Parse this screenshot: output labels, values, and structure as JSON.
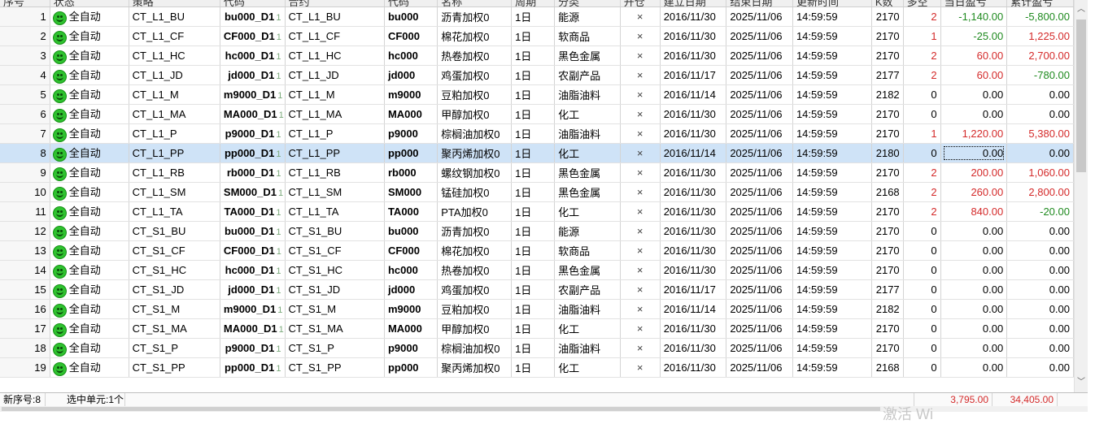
{
  "columns": [
    "序号",
    "状态",
    "策略",
    "代码",
    "合约",
    "代码",
    "名称",
    "周期",
    "分类",
    "开仓",
    "建立日期",
    "结束日期",
    "更新时间",
    "K数",
    "多空",
    "当日盈亏",
    "累计盈亏"
  ],
  "rows": [
    {
      "no": "1",
      "status": "全自动",
      "strategy": "CT_L1_BU",
      "code": "bu000_D1",
      "code_tail": "1",
      "contract": "CT_L1_BU",
      "instr": "bu000",
      "name": "沥青加权0",
      "period": "1日",
      "category": "能源",
      "open": "×",
      "start": "2016/11/30",
      "end": "2025/11/06",
      "time": "14:59:59",
      "kcount": "2170",
      "dir": "2",
      "dir_color": "red",
      "daily": "-1,140.00",
      "daily_color": "green",
      "total": "-5,800.00",
      "total_color": "green"
    },
    {
      "no": "2",
      "status": "全自动",
      "strategy": "CT_L1_CF",
      "code": "CF000_D1",
      "code_tail": "1",
      "contract": "CT_L1_CF",
      "instr": "CF000",
      "name": "棉花加权0",
      "period": "1日",
      "category": "软商品",
      "open": "×",
      "start": "2016/11/30",
      "end": "2025/11/06",
      "time": "14:59:59",
      "kcount": "2170",
      "dir": "1",
      "dir_color": "red",
      "daily": "-25.00",
      "daily_color": "green",
      "total": "1,225.00",
      "total_color": "red"
    },
    {
      "no": "3",
      "status": "全自动",
      "strategy": "CT_L1_HC",
      "code": "hc000_D1",
      "code_tail": "1",
      "contract": "CT_L1_HC",
      "instr": "hc000",
      "name": "热卷加权0",
      "period": "1日",
      "category": "黑色金属",
      "open": "×",
      "start": "2016/11/30",
      "end": "2025/11/06",
      "time": "14:59:59",
      "kcount": "2170",
      "dir": "2",
      "dir_color": "red",
      "daily": "60.00",
      "daily_color": "red",
      "total": "2,700.00",
      "total_color": "red"
    },
    {
      "no": "4",
      "status": "全自动",
      "strategy": "CT_L1_JD",
      "code": "jd000_D1",
      "code_tail": "1",
      "contract": "CT_L1_JD",
      "instr": "jd000",
      "name": "鸡蛋加权0",
      "period": "1日",
      "category": "农副产品",
      "open": "×",
      "start": "2016/11/17",
      "end": "2025/11/06",
      "time": "14:59:59",
      "kcount": "2177",
      "dir": "2",
      "dir_color": "red",
      "daily": "60.00",
      "daily_color": "red",
      "total": "-780.00",
      "total_color": "green"
    },
    {
      "no": "5",
      "status": "全自动",
      "strategy": "CT_L1_M",
      "code": "m9000_D1",
      "code_tail": "1",
      "contract": "CT_L1_M",
      "instr": "m9000",
      "name": "豆粕加权0",
      "period": "1日",
      "category": "油脂油料",
      "open": "×",
      "start": "2016/11/14",
      "end": "2025/11/06",
      "time": "14:59:59",
      "kcount": "2182",
      "dir": "0",
      "dir_color": "black",
      "daily": "0.00",
      "daily_color": "black",
      "total": "0.00",
      "total_color": "black"
    },
    {
      "no": "6",
      "status": "全自动",
      "strategy": "CT_L1_MA",
      "code": "MA000_D1",
      "code_tail": "1",
      "contract": "CT_L1_MA",
      "instr": "MA000",
      "name": "甲醇加权0",
      "period": "1日",
      "category": "化工",
      "open": "×",
      "start": "2016/11/30",
      "end": "2025/11/06",
      "time": "14:59:59",
      "kcount": "2170",
      "dir": "0",
      "dir_color": "black",
      "daily": "0.00",
      "daily_color": "black",
      "total": "0.00",
      "total_color": "black"
    },
    {
      "no": "7",
      "status": "全自动",
      "strategy": "CT_L1_P",
      "code": "p9000_D1",
      "code_tail": "1",
      "contract": "CT_L1_P",
      "instr": "p9000",
      "name": "棕榈油加权0",
      "period": "1日",
      "category": "油脂油料",
      "open": "×",
      "start": "2016/11/30",
      "end": "2025/11/06",
      "time": "14:59:59",
      "kcount": "2170",
      "dir": "1",
      "dir_color": "red",
      "daily": "1,220.00",
      "daily_color": "red",
      "total": "5,380.00",
      "total_color": "red"
    },
    {
      "no": "8",
      "status": "全自动",
      "strategy": "CT_L1_PP",
      "code": "pp000_D1",
      "code_tail": "1",
      "contract": "CT_L1_PP",
      "instr": "pp000",
      "name": "聚丙烯加权0",
      "period": "1日",
      "category": "化工",
      "open": "×",
      "start": "2016/11/14",
      "end": "2025/11/06",
      "time": "14:59:59",
      "kcount": "2180",
      "dir": "0",
      "dir_color": "black",
      "daily": "0.00",
      "daily_color": "black",
      "total": "0.00",
      "total_color": "black",
      "selected": true
    },
    {
      "no": "9",
      "status": "全自动",
      "strategy": "CT_L1_RB",
      "code": "rb000_D1",
      "code_tail": "1",
      "contract": "CT_L1_RB",
      "instr": "rb000",
      "name": "螺纹钢加权0",
      "period": "1日",
      "category": "黑色金属",
      "open": "×",
      "start": "2016/11/30",
      "end": "2025/11/06",
      "time": "14:59:59",
      "kcount": "2170",
      "dir": "2",
      "dir_color": "red",
      "daily": "200.00",
      "daily_color": "red",
      "total": "1,060.00",
      "total_color": "red"
    },
    {
      "no": "10",
      "status": "全自动",
      "strategy": "CT_L1_SM",
      "code": "SM000_D1",
      "code_tail": "1",
      "contract": "CT_L1_SM",
      "instr": "SM000",
      "name": "锰硅加权0",
      "period": "1日",
      "category": "黑色金属",
      "open": "×",
      "start": "2016/11/30",
      "end": "2025/11/06",
      "time": "14:59:59",
      "kcount": "2168",
      "dir": "2",
      "dir_color": "red",
      "daily": "260.00",
      "daily_color": "red",
      "total": "2,800.00",
      "total_color": "red"
    },
    {
      "no": "11",
      "status": "全自动",
      "strategy": "CT_L1_TA",
      "code": "TA000_D1",
      "code_tail": "1",
      "contract": "CT_L1_TA",
      "instr": "TA000",
      "name": "PTA加权0",
      "period": "1日",
      "category": "化工",
      "open": "×",
      "start": "2016/11/30",
      "end": "2025/11/06",
      "time": "14:59:59",
      "kcount": "2170",
      "dir": "2",
      "dir_color": "red",
      "daily": "840.00",
      "daily_color": "red",
      "total": "-20.00",
      "total_color": "green"
    },
    {
      "no": "12",
      "status": "全自动",
      "strategy": "CT_S1_BU",
      "code": "bu000_D1",
      "code_tail": "1",
      "contract": "CT_S1_BU",
      "instr": "bu000",
      "name": "沥青加权0",
      "period": "1日",
      "category": "能源",
      "open": "×",
      "start": "2016/11/30",
      "end": "2025/11/06",
      "time": "14:59:59",
      "kcount": "2170",
      "dir": "0",
      "dir_color": "black",
      "daily": "0.00",
      "daily_color": "black",
      "total": "0.00",
      "total_color": "black"
    },
    {
      "no": "13",
      "status": "全自动",
      "strategy": "CT_S1_CF",
      "code": "CF000_D1",
      "code_tail": "1",
      "contract": "CT_S1_CF",
      "instr": "CF000",
      "name": "棉花加权0",
      "period": "1日",
      "category": "软商品",
      "open": "×",
      "start": "2016/11/30",
      "end": "2025/11/06",
      "time": "14:59:59",
      "kcount": "2170",
      "dir": "0",
      "dir_color": "black",
      "daily": "0.00",
      "daily_color": "black",
      "total": "0.00",
      "total_color": "black"
    },
    {
      "no": "14",
      "status": "全自动",
      "strategy": "CT_S1_HC",
      "code": "hc000_D1",
      "code_tail": "1",
      "contract": "CT_S1_HC",
      "instr": "hc000",
      "name": "热卷加权0",
      "period": "1日",
      "category": "黑色金属",
      "open": "×",
      "start": "2016/11/30",
      "end": "2025/11/06",
      "time": "14:59:59",
      "kcount": "2170",
      "dir": "0",
      "dir_color": "black",
      "daily": "0.00",
      "daily_color": "black",
      "total": "0.00",
      "total_color": "black"
    },
    {
      "no": "15",
      "status": "全自动",
      "strategy": "CT_S1_JD",
      "code": "jd000_D1",
      "code_tail": "1",
      "contract": "CT_S1_JD",
      "instr": "jd000",
      "name": "鸡蛋加权0",
      "period": "1日",
      "category": "农副产品",
      "open": "×",
      "start": "2016/11/17",
      "end": "2025/11/06",
      "time": "14:59:59",
      "kcount": "2177",
      "dir": "0",
      "dir_color": "black",
      "daily": "0.00",
      "daily_color": "black",
      "total": "0.00",
      "total_color": "black"
    },
    {
      "no": "16",
      "status": "全自动",
      "strategy": "CT_S1_M",
      "code": "m9000_D1",
      "code_tail": "1",
      "contract": "CT_S1_M",
      "instr": "m9000",
      "name": "豆粕加权0",
      "period": "1日",
      "category": "油脂油料",
      "open": "×",
      "start": "2016/11/14",
      "end": "2025/11/06",
      "time": "14:59:59",
      "kcount": "2182",
      "dir": "0",
      "dir_color": "black",
      "daily": "0.00",
      "daily_color": "black",
      "total": "0.00",
      "total_color": "black"
    },
    {
      "no": "17",
      "status": "全自动",
      "strategy": "CT_S1_MA",
      "code": "MA000_D1",
      "code_tail": "1",
      "contract": "CT_S1_MA",
      "instr": "MA000",
      "name": "甲醇加权0",
      "period": "1日",
      "category": "化工",
      "open": "×",
      "start": "2016/11/30",
      "end": "2025/11/06",
      "time": "14:59:59",
      "kcount": "2170",
      "dir": "0",
      "dir_color": "black",
      "daily": "0.00",
      "daily_color": "black",
      "total": "0.00",
      "total_color": "black"
    },
    {
      "no": "18",
      "status": "全自动",
      "strategy": "CT_S1_P",
      "code": "p9000_D1",
      "code_tail": "1",
      "contract": "CT_S1_P",
      "instr": "p9000",
      "name": "棕榈油加权0",
      "period": "1日",
      "category": "油脂油料",
      "open": "×",
      "start": "2016/11/30",
      "end": "2025/11/06",
      "time": "14:59:59",
      "kcount": "2170",
      "dir": "0",
      "dir_color": "black",
      "daily": "0.00",
      "daily_color": "black",
      "total": "0.00",
      "total_color": "black"
    },
    {
      "no": "19",
      "status": "全自动",
      "strategy": "CT_S1_PP",
      "code": "pp000_D1",
      "code_tail": "1",
      "contract": "CT_S1_PP",
      "instr": "pp000",
      "name": "聚丙烯加权0",
      "period": "1日",
      "category": "化工",
      "open": "×",
      "start": "2016/11/30",
      "end": "2025/11/06",
      "time": "14:59:59",
      "kcount": "2168",
      "dir": "0",
      "dir_color": "black",
      "daily": "0.00",
      "daily_color": "black",
      "total": "0.00",
      "total_color": "black"
    }
  ],
  "footer": {
    "new_seq": "新序号:8",
    "selected_cells": "选中单元:1个",
    "daily_sum": "3,795.00",
    "total_sum": "34,405.00"
  },
  "watermark": "激活 Wi",
  "colors": {
    "positive": "#d42a2a",
    "negative": "#1f8a1f",
    "selected_row": "#cfe3f7",
    "status_icon": "#2fc22f"
  },
  "icons": {
    "status": "smiley-face-icon",
    "scroll_up": "chevron-up-icon",
    "scroll_down": "chevron-down-icon"
  }
}
